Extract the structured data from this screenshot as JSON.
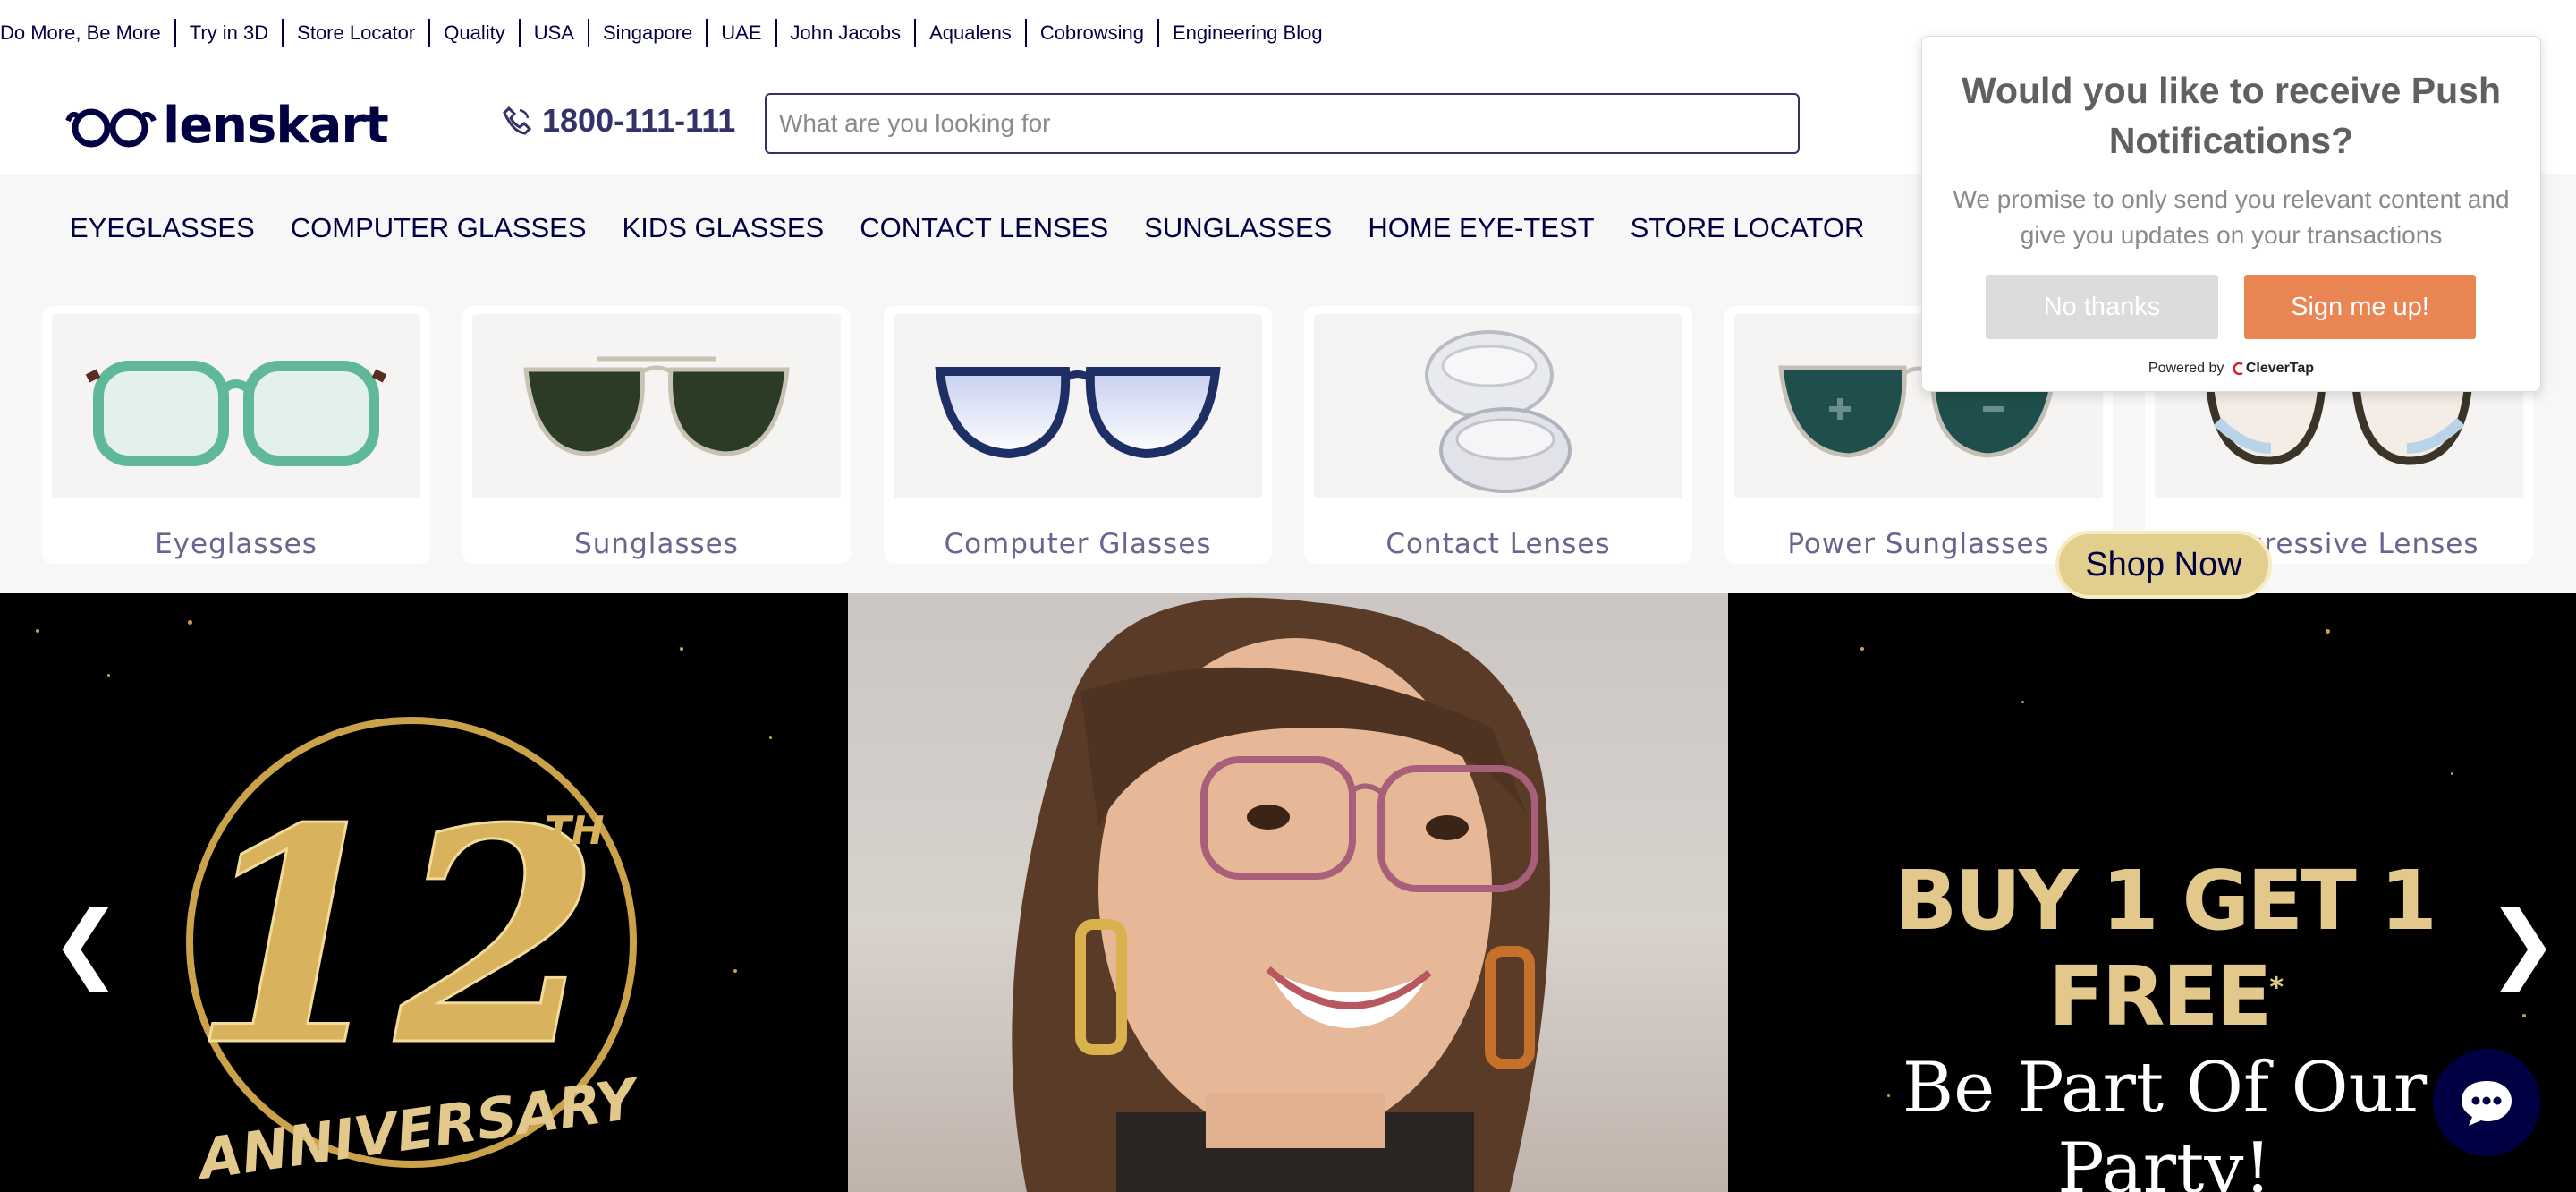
{
  "top_links": [
    "Do More, Be More",
    "Try in 3D",
    "Store Locator",
    "Quality",
    "USA",
    "Singapore",
    "UAE",
    "John Jacobs",
    "Aqualens",
    "Cobrowsing",
    "Engineering Blog"
  ],
  "header": {
    "logo_text": "lenskart",
    "phone": "1800-111-111",
    "search_placeholder": "What are you looking for"
  },
  "main_nav": [
    "EYEGLASSES",
    "COMPUTER GLASSES",
    "KIDS GLASSES",
    "CONTACT LENSES",
    "SUNGLASSES",
    "HOME EYE-TEST",
    "STORE LOCATOR"
  ],
  "categories": [
    {
      "label": "Eyeglasses",
      "icon": "green-eyeglasses-icon"
    },
    {
      "label": "Sunglasses",
      "icon": "aviator-sunglasses-icon"
    },
    {
      "label": "Computer Glasses",
      "icon": "blue-computer-glasses-icon"
    },
    {
      "label": "Contact Lenses",
      "icon": "contact-lens-icon"
    },
    {
      "label": "Power Sunglasses",
      "icon": "power-sunglasses-icon"
    },
    {
      "label": "Progressive Lenses",
      "icon": "progressive-lenses-icon"
    }
  ],
  "hero": {
    "anniversary_number": "12",
    "anniversary_suffix": "TH",
    "anniversary_word": "ANNIVERSARY",
    "offer": "BUY 1 GET 1 FREE",
    "offer_mark": "*",
    "tagline": "Be Part Of Our Party!",
    "cta": "Shop Now",
    "prev": "❮",
    "next": "❯"
  },
  "popup": {
    "title": "Would you like to receive Push Notifications?",
    "body": "We promise to only send you relevant content and give you updates on your transactions",
    "decline": "No thanks",
    "accept": "Sign me up!",
    "powered_by": "Powered by",
    "provider": "CleverTap"
  },
  "colors": {
    "brand_navy": "#000042",
    "accent_orange": "#ea8653",
    "gold": "#e2c98b"
  }
}
